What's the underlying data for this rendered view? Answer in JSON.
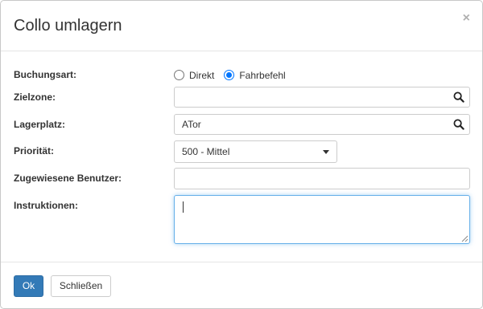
{
  "dialog": {
    "title": "Collo umlagern",
    "close_symbol": "×"
  },
  "form": {
    "buchungsart": {
      "label": "Buchungsart:",
      "options": [
        {
          "label": "Direkt",
          "checked": false
        },
        {
          "label": "Fahrbefehl",
          "checked": true
        }
      ]
    },
    "zielzone": {
      "label": "Zielzone:",
      "value": "",
      "icon": "search-icon"
    },
    "lagerplatz": {
      "label": "Lagerplatz:",
      "value": "ATor",
      "icon": "search-icon"
    },
    "prioritaet": {
      "label": "Priorität:",
      "selected": "500 - Mittel"
    },
    "zugewiesene_benutzer": {
      "label": "Zugewiesene Benutzer:",
      "value": ""
    },
    "instruktionen": {
      "label": "Instruktionen:",
      "value": ""
    }
  },
  "footer": {
    "ok_label": "Ok",
    "close_label": "Schließen"
  },
  "colors": {
    "primary": "#337ab7",
    "focus": "#66afe9",
    "radio_checked": "#0075ff"
  }
}
